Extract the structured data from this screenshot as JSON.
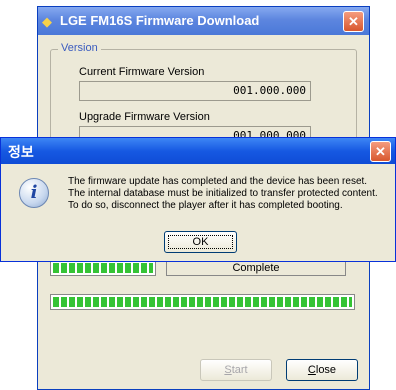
{
  "background_window": {
    "title": "LGE FM16S Firmware Download",
    "group_label": "Version",
    "current_label": "Current Firmware Version",
    "current_value": "001.000.000",
    "upgrade_label": "Upgrade Firmware Version",
    "upgrade_value": "001.000.000",
    "status_text": "Complete",
    "small_progress_fraction": 1.0,
    "main_progress_fraction": 1.0,
    "start_button": "Start",
    "close_button": "Close",
    "progress_color": "#35c335"
  },
  "dialog": {
    "title": "정보",
    "message_lines": [
      "The firmware update has completed and the device has been reset.",
      "The internal database must be initialized to transfer protected content.",
      "To do so, disconnect the player after it has completed booting."
    ],
    "ok_button": "OK",
    "icon": "info-icon"
  },
  "colors": {
    "titlebar_blue": "#1659e2",
    "window_face": "#ece9d8",
    "close_red": "#d8572e"
  }
}
